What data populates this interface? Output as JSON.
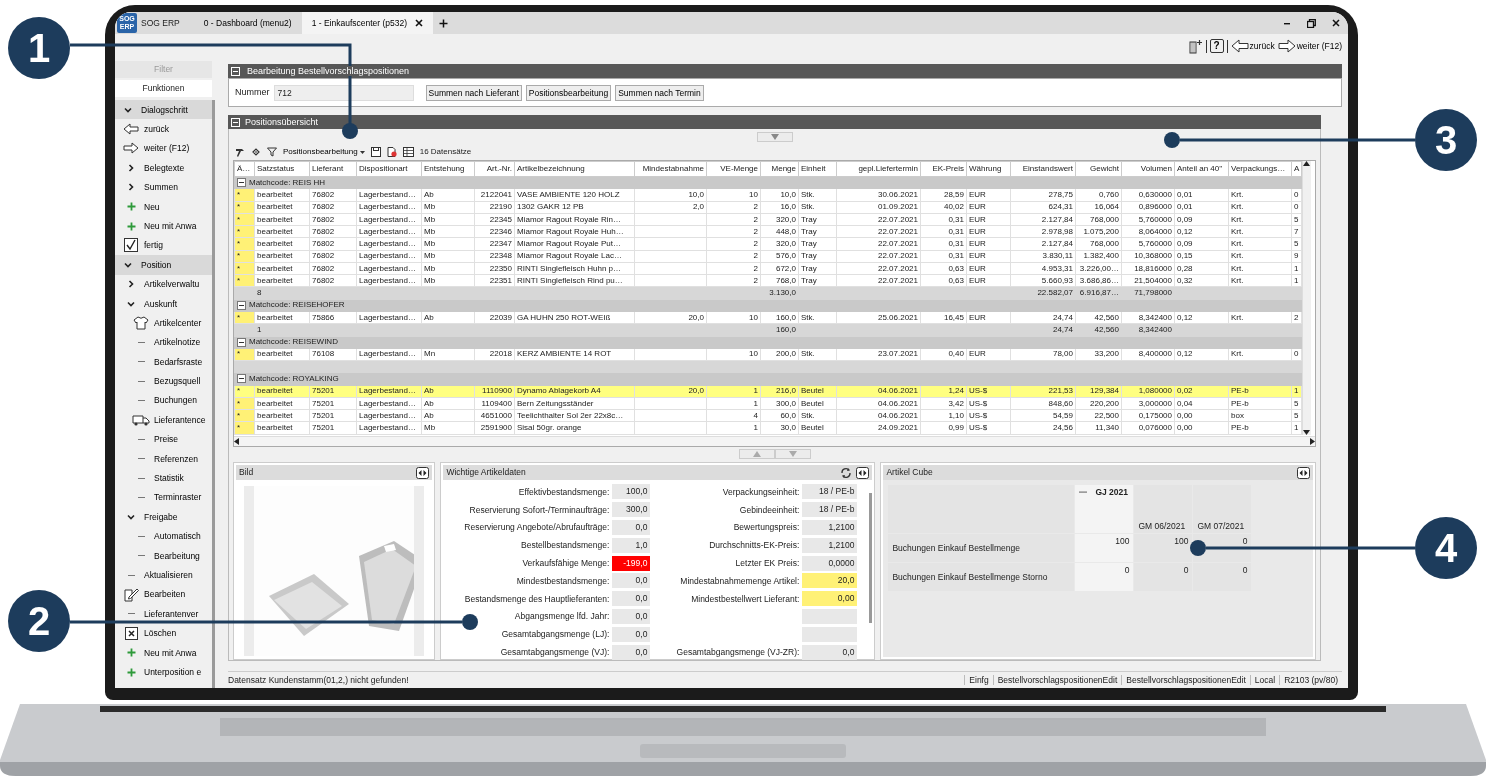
{
  "app": {
    "logo": [
      "SOG",
      "ERP"
    ],
    "name": "SOG ERP"
  },
  "tabs": [
    {
      "label": "0 - Dashboard (menu2)",
      "selected": false
    },
    {
      "label": "1 - Einkaufscenter (p532)",
      "selected": true
    }
  ],
  "toolbar": {
    "help": "?",
    "back": "zurück",
    "forward": "weiter (F12)"
  },
  "sidebar": {
    "tabs": [
      {
        "label": "Filter",
        "selected": false
      },
      {
        "label": "Funktionen",
        "selected": true
      }
    ],
    "items": [
      {
        "label": "Dialogschritt",
        "kind": "group",
        "expanded": true,
        "children": [
          {
            "label": "zurück",
            "kind": "back"
          },
          {
            "label": "weiter (F12)",
            "kind": "forward"
          },
          {
            "label": "Belegtexte",
            "kind": "folder",
            "expanded": false
          },
          {
            "label": "Summen",
            "kind": "folder",
            "expanded": false
          },
          {
            "label": "Neu",
            "kind": "add"
          },
          {
            "label": "Neu mit Anwa",
            "kind": "add"
          },
          {
            "label": "fertig",
            "kind": "done"
          }
        ]
      },
      {
        "label": "Position",
        "kind": "group",
        "expanded": true,
        "children": [
          {
            "label": "Artikelverwaltu",
            "kind": "folder",
            "expanded": false
          },
          {
            "label": "Auskunft",
            "kind": "folder",
            "expanded": true,
            "children": [
              {
                "label": "Artikelcenter",
                "kind": "article"
              },
              {
                "label": "Artikelnotize",
                "kind": "leaf"
              },
              {
                "label": "Bedarfsraste",
                "kind": "leaf"
              },
              {
                "label": "Bezugsquell",
                "kind": "leaf"
              },
              {
                "label": "Buchungen",
                "kind": "leaf"
              },
              {
                "label": "Lieferantence",
                "kind": "supplier"
              },
              {
                "label": "Preise",
                "kind": "leaf"
              },
              {
                "label": "Referenzen",
                "kind": "leaf"
              },
              {
                "label": "Statistik",
                "kind": "leaf"
              },
              {
                "label": "Terminraster",
                "kind": "leaf"
              }
            ]
          },
          {
            "label": "Freigabe",
            "kind": "folder",
            "expanded": true,
            "children": [
              {
                "label": "Automatisch",
                "kind": "leaf"
              },
              {
                "label": "Bearbeitung",
                "kind": "leaf"
              }
            ]
          },
          {
            "label": "Aktualisieren",
            "kind": "leaf"
          },
          {
            "label": "Bearbeiten",
            "kind": "edit"
          },
          {
            "label": "Lieferantenver",
            "kind": "leaf"
          },
          {
            "label": "Löschen",
            "kind": "delete"
          },
          {
            "label": "Neu mit Anwa",
            "kind": "add"
          },
          {
            "label": "Unterposition e",
            "kind": "add"
          }
        ]
      }
    ]
  },
  "edit_panel": {
    "title": "Bearbeitung Bestellvorschlagspositionen",
    "number_label": "Nummer",
    "number_value": "712",
    "buttons": [
      "Summen nach Lieferant",
      "Positionsbearbeitung",
      "Summen nach Termin"
    ]
  },
  "overview": {
    "title": "Positionsübersicht",
    "view": "Positionsbearbeitung",
    "record_count": "16 Datensätze"
  },
  "table": {
    "columns": [
      "Ä…",
      "Satzstatus",
      "Lieferant",
      "Dispositionart",
      "Entstehung",
      "Art.-Nr.",
      "Artikelbezeichnung",
      "Mindestabnahme",
      "VE-Menge",
      "Menge",
      "Einheit",
      "gepl.Liefertermin",
      "EK-Preis",
      "Währung",
      "Einstandswert",
      "Gewicht",
      "Volumen",
      "Anteil an 40''",
      "Verpackungs…",
      "A"
    ],
    "groups": [
      {
        "matchcode": "Matchcode: REIS HH",
        "rows": [
          {
            "selected": false,
            "cells": [
              "*",
              "bearbeitet",
              "76802",
              "Lagerbestand…",
              "Ab",
              "2122041",
              "VASE AMBIENTE 120 HOLZ",
              "10,0",
              "10",
              "10,0",
              "Stk.",
              "30.06.2021",
              "28,59",
              "EUR",
              "278,75",
              "0,760",
              "0,630000",
              "0,01",
              "Krt.",
              "0"
            ]
          },
          {
            "selected": false,
            "cells": [
              "*",
              "bearbeitet",
              "76802",
              "Lagerbestand…",
              "Mb",
              "22190",
              "1302 GAKR 12 PB",
              "2,0",
              "2",
              "16,0",
              "Stk.",
              "01.09.2021",
              "40,02",
              "EUR",
              "624,31",
              "16,064",
              "0,896000",
              "0,01",
              "Krt.",
              "0"
            ]
          },
          {
            "selected": false,
            "cells": [
              "*",
              "bearbeitet",
              "76802",
              "Lagerbestand…",
              "Mb",
              "22345",
              "Miamor Ragout Royale Rin…",
              null,
              "2",
              "320,0",
              "Tray",
              "22.07.2021",
              "0,31",
              "EUR",
              "2.127,84",
              "768,000",
              "5,760000",
              "0,09",
              "Krt.",
              "5"
            ]
          },
          {
            "selected": false,
            "cells": [
              "*",
              "bearbeitet",
              "76802",
              "Lagerbestand…",
              "Mb",
              "22346",
              "Miamor Ragout Royale Huh…",
              null,
              "2",
              "448,0",
              "Tray",
              "22.07.2021",
              "0,31",
              "EUR",
              "2.978,98",
              "1.075,200",
              "8,064000",
              "0,12",
              "Krt.",
              "7"
            ]
          },
          {
            "selected": false,
            "cells": [
              "*",
              "bearbeitet",
              "76802",
              "Lagerbestand…",
              "Mb",
              "22347",
              "Miamor Ragout Royale Put…",
              null,
              "2",
              "320,0",
              "Tray",
              "22.07.2021",
              "0,31",
              "EUR",
              "2.127,84",
              "768,000",
              "5,760000",
              "0,09",
              "Krt.",
              "5"
            ]
          },
          {
            "selected": false,
            "cells": [
              "*",
              "bearbeitet",
              "76802",
              "Lagerbestand…",
              "Mb",
              "22348",
              "Miamor Ragout Royale Lac…",
              null,
              "2",
              "576,0",
              "Tray",
              "22.07.2021",
              "0,31",
              "EUR",
              "3.830,11",
              "1.382,400",
              "10,368000",
              "0,15",
              "Krt.",
              "9"
            ]
          },
          {
            "selected": false,
            "cells": [
              "*",
              "bearbeitet",
              "76802",
              "Lagerbestand…",
              "Mb",
              "22350",
              "RINTI Singlefleisch Huhn p…",
              null,
              "2",
              "672,0",
              "Tray",
              "22.07.2021",
              "0,63",
              "EUR",
              "4.953,31",
              "3.226,00…",
              "18,816000",
              "0,28",
              "Krt.",
              "1"
            ]
          },
          {
            "selected": false,
            "cells": [
              "*",
              "bearbeitet",
              "76802",
              "Lagerbestand…",
              "Mb",
              "22351",
              "RINTI Singlefleisch Rind pu…",
              null,
              "2",
              "768,0",
              "Tray",
              "22.07.2021",
              "0,63",
              "EUR",
              "5.660,93",
              "3.686,86…",
              "21,504000",
              "0,32",
              "Krt.",
              "1"
            ]
          }
        ],
        "summary": {
          "count": "8",
          "menge": "3.130,0",
          "einstandswert": "22.582,07",
          "gewicht": "6.916,87…",
          "volumen": "71,798000"
        }
      },
      {
        "matchcode": "Matchcode: REISEHOFER",
        "rows": [
          {
            "selected": false,
            "cells": [
              "*",
              "bearbeitet",
              "75866",
              "Lagerbestand…",
              "Ab",
              "22039",
              "GA HUHN 250 ROT-WEIß",
              "20,0",
              "10",
              "160,0",
              "Stk.",
              "25.06.2021",
              "16,45",
              "EUR",
              "24,74",
              "42,560",
              "8,342400",
              "0,12",
              "Krt.",
              "2"
            ]
          }
        ],
        "summary": {
          "count": "1",
          "menge": "160,0",
          "einstandswert": "24,74",
          "gewicht": "42,560",
          "volumen": "8,342400"
        }
      },
      {
        "matchcode": "Matchcode: REISEWIND",
        "rows": [
          {
            "selected": false,
            "cells": [
              "*",
              "bearbeitet",
              "76108",
              "Lagerbestand…",
              "Mn",
              "22018",
              "KERZ AMBIENTE 14 ROT",
              null,
              "10",
              "200,0",
              "Stk.",
              "23.07.2021",
              "0,40",
              "EUR",
              "78,00",
              "33,200",
              "8,400000",
              "0,12",
              "Krt.",
              "0"
            ]
          }
        ],
        "total_row": true
      },
      {
        "matchcode": "Matchcode: ROYALKING",
        "rows": [
          {
            "selected": true,
            "cells": [
              "*",
              "bearbeitet",
              "75201",
              "Lagerbestand…",
              "Ab",
              "1110900",
              "Dynamo Ablagekorb A4",
              "20,0",
              "1",
              "216,0",
              "Beutel",
              "04.06.2021",
              "1,24",
              "US-$",
              "221,53",
              "129,384",
              "1,080000",
              "0,02",
              "PE-b",
              "1"
            ]
          },
          {
            "selected": false,
            "cells": [
              "*",
              "bearbeitet",
              "75201",
              "Lagerbestand…",
              "Ab",
              "1109400",
              "Bern Zeitungsständer",
              null,
              "1",
              "300,0",
              "Beutel",
              "04.06.2021",
              "3,42",
              "US-$",
              "848,60",
              "220,200",
              "3,000000",
              "0,04",
              "PE-b",
              "5"
            ]
          },
          {
            "selected": false,
            "cells": [
              "*",
              "bearbeitet",
              "75201",
              "Lagerbestand…",
              "Ab",
              "4651000",
              "Teelichthalter Sol 2er 22x8c…",
              null,
              "4",
              "60,0",
              "Stk.",
              "04.06.2021",
              "1,10",
              "US-$",
              "54,59",
              "22,500",
              "0,175000",
              "0,00",
              "box",
              "5"
            ]
          },
          {
            "selected": false,
            "cells": [
              "*",
              "bearbeitet",
              "75201",
              "Lagerbestand…",
              "Mb",
              "2591900",
              "Sisal 50gr. orange",
              null,
              "1",
              "30,0",
              "Beutel",
              "24.09.2021",
              "0,99",
              "US-$",
              "24,56",
              "11,340",
              "0,076000",
              "0,00",
              "PE-b",
              "1"
            ]
          }
        ]
      }
    ]
  },
  "image_panel": {
    "title": "Bild"
  },
  "article_panel": {
    "title": "Wichtige Artikeldaten",
    "left": [
      {
        "label": "Effektivbestandsmenge:",
        "value": "100,0"
      },
      {
        "label": "Reservierung Sofort-/Terminaufträge:",
        "value": "300,0"
      },
      {
        "label": "Reservierung Angebote/Abrufaufträge:",
        "value": "0,0"
      },
      {
        "label": "Bestellbestandsmenge:",
        "value": "1,0"
      },
      {
        "label": "Verkaufsfähige Menge:",
        "value": "-199,0",
        "color": "#ff0000"
      },
      {
        "label": "Mindestbestandsmenge:",
        "value": "0,0"
      },
      {
        "label": "Bestandsmenge des Hauptlieferanten:",
        "value": "0,0"
      },
      {
        "label": "Abgangsmenge lfd. Jahr:",
        "value": "0,0"
      },
      {
        "label": "Gesamtabgangsmenge (LJ):",
        "value": "0,0"
      },
      {
        "label": "Gesamtabgangsmenge (VJ):",
        "value": "0,0"
      }
    ],
    "right": [
      {
        "kind": "field",
        "label": "Verpackungseinheit:",
        "value": "18 / PE-b"
      },
      {
        "kind": "field",
        "label": "Gebindeeinheit:",
        "value": "18 / PE-b"
      },
      {
        "kind": "field",
        "label": "Bewertungspreis:",
        "value": "1,2100"
      },
      {
        "kind": "field",
        "label": "Durchschnitts-EK-Preis:",
        "value": "1,2100"
      },
      {
        "kind": "field",
        "label": "Letzter EK Preis:",
        "value": "0,0000"
      },
      {
        "kind": "field",
        "label": "Mindestabnahmemenge Artikel:",
        "value": "20,0",
        "color": "#fff176"
      },
      {
        "kind": "field",
        "label": "Mindestbestellwert Lieferant:",
        "value": "0,00",
        "color": "#fff176"
      },
      {
        "kind": "blank"
      },
      {
        "kind": "blank"
      },
      {
        "kind": "field",
        "label": "Gesamtabgangsmenge (VJ-ZR):",
        "value": "0,0"
      }
    ]
  },
  "cube_panel": {
    "title": "Artikel Cube",
    "year": "GJ 2021",
    "expanded": true,
    "months": [
      "GM 06/2021",
      "GM 07/2021"
    ],
    "rows": [
      {
        "label": "Buchungen Einkauf Bestellmenge",
        "values": [
          "100",
          "100",
          "0"
        ]
      },
      {
        "label": "Buchungen Einkauf Bestellmenge Storno",
        "values": [
          "0",
          "0",
          "0"
        ]
      }
    ]
  },
  "status_bar": {
    "message": "Datensatz Kundenstamm(01,2,) nicht gefunden!",
    "segments": [
      "Einfg",
      "BestellvorschlagspositionenEdit",
      "BestellvorschlagspositionenEdit",
      "Local",
      "R2103 (pv/80)"
    ]
  },
  "callouts": [
    {
      "label": "1"
    },
    {
      "label": "2"
    },
    {
      "label": "3"
    },
    {
      "label": "4"
    }
  ]
}
